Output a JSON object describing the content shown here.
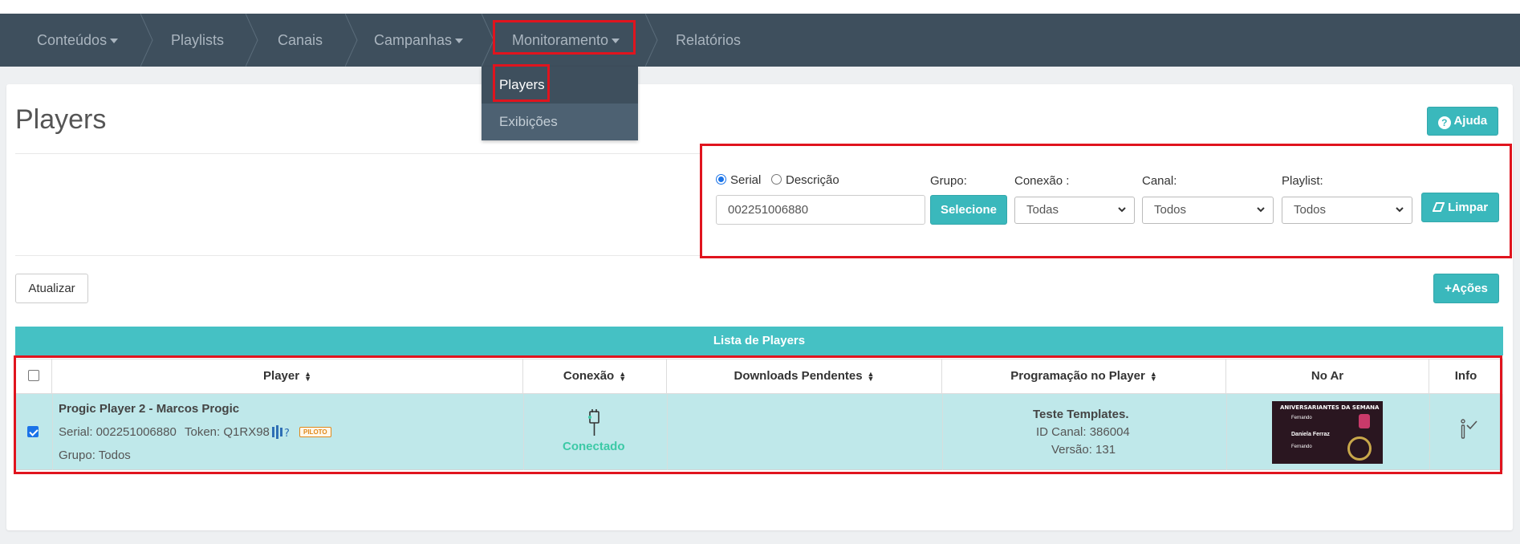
{
  "nav": {
    "items": [
      {
        "label": "Conteúdos",
        "has_caret": true
      },
      {
        "label": "Playlists",
        "has_caret": false
      },
      {
        "label": "Canais",
        "has_caret": false
      },
      {
        "label": "Campanhas",
        "has_caret": true
      },
      {
        "label": "Monitoramento",
        "has_caret": true
      },
      {
        "label": "Relatórios",
        "has_caret": false
      }
    ],
    "dropdown": [
      "Players",
      "Exibições"
    ]
  },
  "page": {
    "title": "Players",
    "help_label": "Ajuda",
    "refresh_label": "Atualizar",
    "actions_label": "+Ações"
  },
  "filters": {
    "radio_serial": "Serial",
    "radio_descricao": "Descrição",
    "search_value": "002251006880",
    "grupo_label": "Grupo:",
    "grupo_button": "Selecione",
    "conexao_label": "Conexão :",
    "conexao_value": "Todas",
    "canal_label": "Canal:",
    "canal_value": "Todos",
    "playlist_label": "Playlist:",
    "playlist_value": "Todos",
    "clear_label": "Limpar"
  },
  "table": {
    "title": "Lista de Players",
    "headers": [
      "Player",
      "Conexão",
      "Downloads Pendentes",
      "Programação no Player",
      "No Ar",
      "Info"
    ],
    "row": {
      "name": "Progic Player 2 - Marcos Progic",
      "serial_line": "Serial: 002251006880",
      "token_line": "Token: Q1RX98",
      "badge": "PILOTO",
      "group_line": "Grupo: Todos",
      "connection": "Conectado",
      "program_title": "Teste Templates.",
      "canal_id": "ID Canal: 386004",
      "version": "Versão: 131",
      "thumb_title": "ANIVERSARIANTES DA SEMANA",
      "thumb_names": [
        "Fernando",
        "Daniela Ferraz",
        "Fernando"
      ]
    }
  },
  "colors": {
    "nav_bg": "#3e4f5d",
    "accent": "#3ab8bc",
    "row_selected": "#bfe8ea",
    "connected": "#3cc9a6",
    "highlight": "#e0141e"
  }
}
